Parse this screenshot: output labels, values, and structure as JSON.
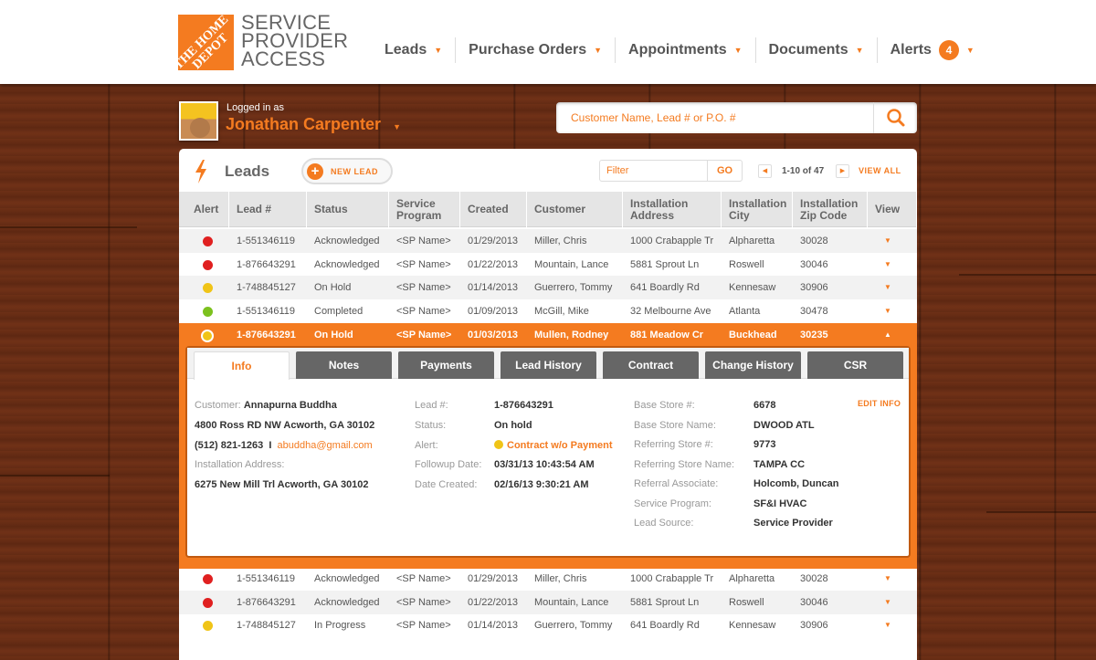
{
  "logo": {
    "text": "THE HOME DEPOT",
    "line1": "SERVICE",
    "line2": "PROVIDER",
    "line3": "ACCESS"
  },
  "nav": [
    {
      "label": "Leads"
    },
    {
      "label": "Purchase Orders"
    },
    {
      "label": "Appointments"
    },
    {
      "label": "Documents"
    },
    {
      "label": "Alerts",
      "badge": "4"
    }
  ],
  "user": {
    "logged_label": "Logged in as",
    "name": "Jonathan Carpenter"
  },
  "search": {
    "placeholder": "Customer Name, Lead # or P.O. #"
  },
  "panel": {
    "title": "Leads",
    "new_lead": "NEW LEAD",
    "filter_placeholder": "Filter",
    "go": "GO",
    "pagination": "1-10 of 47",
    "view_all": "VIEW ALL"
  },
  "columns": [
    "Alert",
    "Lead #",
    "Status",
    "Service Program",
    "Created",
    "Customer",
    "Installation Address",
    "Installation City",
    "Installation Zip Code",
    "View"
  ],
  "rows": [
    {
      "alert": "red",
      "lead": "1-551346119",
      "status": "Acknowledged",
      "program": "<SP Name>",
      "created": "01/29/2013",
      "customer": "Miller, Chris",
      "address": "1000 Crabapple Tr",
      "city": "Alpharetta",
      "zip": "30028"
    },
    {
      "alert": "red",
      "lead": "1-876643291",
      "status": "Acknowledged",
      "program": "<SP Name>",
      "created": "01/22/2013",
      "customer": "Mountain, Lance",
      "address": "5881 Sprout Ln",
      "city": "Roswell",
      "zip": "30046"
    },
    {
      "alert": "yellow",
      "lead": "1-748845127",
      "status": "On Hold",
      "program": "<SP Name>",
      "created": "01/14/2013",
      "customer": "Guerrero, Tommy",
      "address": "641 Boardly Rd",
      "city": "Kennesaw",
      "zip": "30906"
    },
    {
      "alert": "green",
      "lead": "1-551346119",
      "status": "Completed",
      "program": "<SP Name>",
      "created": "01/09/2013",
      "customer": "McGill, Mike",
      "address": "32 Melbourne Ave",
      "city": "Atlanta",
      "zip": "30478"
    },
    {
      "alert": "yellow",
      "lead": "1-876643291",
      "status": "On Hold",
      "program": "<SP Name>",
      "created": "01/03/2013",
      "customer": "Mullen, Rodney",
      "address": "881 Meadow Cr",
      "city": "Buckhead",
      "zip": "30235"
    },
    {
      "alert": "red",
      "lead": "1-551346119",
      "status": "Acknowledged",
      "program": "<SP Name>",
      "created": "01/29/2013",
      "customer": "Miller, Chris",
      "address": "1000 Crabapple Tr",
      "city": "Alpharetta",
      "zip": "30028"
    },
    {
      "alert": "red",
      "lead": "1-876643291",
      "status": "Acknowledged",
      "program": "<SP Name>",
      "created": "01/22/2013",
      "customer": "Mountain, Lance",
      "address": "5881 Sprout Ln",
      "city": "Roswell",
      "zip": "30046"
    },
    {
      "alert": "yellow",
      "lead": "1-748845127",
      "status": "In Progress",
      "program": "<SP Name>",
      "created": "01/14/2013",
      "customer": "Guerrero, Tommy",
      "address": "641 Boardly Rd",
      "city": "Kennesaw",
      "zip": "30906"
    }
  ],
  "detail": {
    "tabs": [
      "Info",
      "Notes",
      "Payments",
      "Lead History",
      "Contract",
      "Change History",
      "CSR"
    ],
    "customer_label": "Customer:",
    "customer_name": "Annapurna Buddha",
    "customer_address": "4800 Ross RD NW Acworth, GA 30102",
    "phone": "(512) 821-1263",
    "sep": "I",
    "email": "abuddha@gmail.com",
    "install_label": "Installation Address:",
    "install_address": "6275 New Mill Trl Acworth, GA 30102",
    "mid": [
      {
        "label": "Lead #:",
        "value": "1-876643291"
      },
      {
        "label": "Status:",
        "value": "On hold"
      },
      {
        "label": "Alert:",
        "value": "Contract w/o Payment"
      },
      {
        "label": "Followup Date:",
        "value": "03/31/13 10:43:54 AM"
      },
      {
        "label": "Date Created:",
        "value": "02/16/13 9:30:21 AM"
      }
    ],
    "right": [
      {
        "label": "Base Store #:",
        "value": "6678"
      },
      {
        "label": "Base Store Name:",
        "value": "DWOOD ATL"
      },
      {
        "label": "Referring Store #:",
        "value": "9773"
      },
      {
        "label": "Referring Store Name:",
        "value": "TAMPA CC"
      },
      {
        "label": "Referral Associate:",
        "value": "Holcomb, Duncan"
      },
      {
        "label": "Service Program:",
        "value": "SF&I HVAC"
      },
      {
        "label": "Lead Source:",
        "value": "Service Provider"
      }
    ],
    "edit_info": "EDIT INFO"
  },
  "colors": {
    "accent": "#f47b20",
    "red": "#e02020",
    "yellow": "#f0c417",
    "green": "#7cc11e"
  }
}
